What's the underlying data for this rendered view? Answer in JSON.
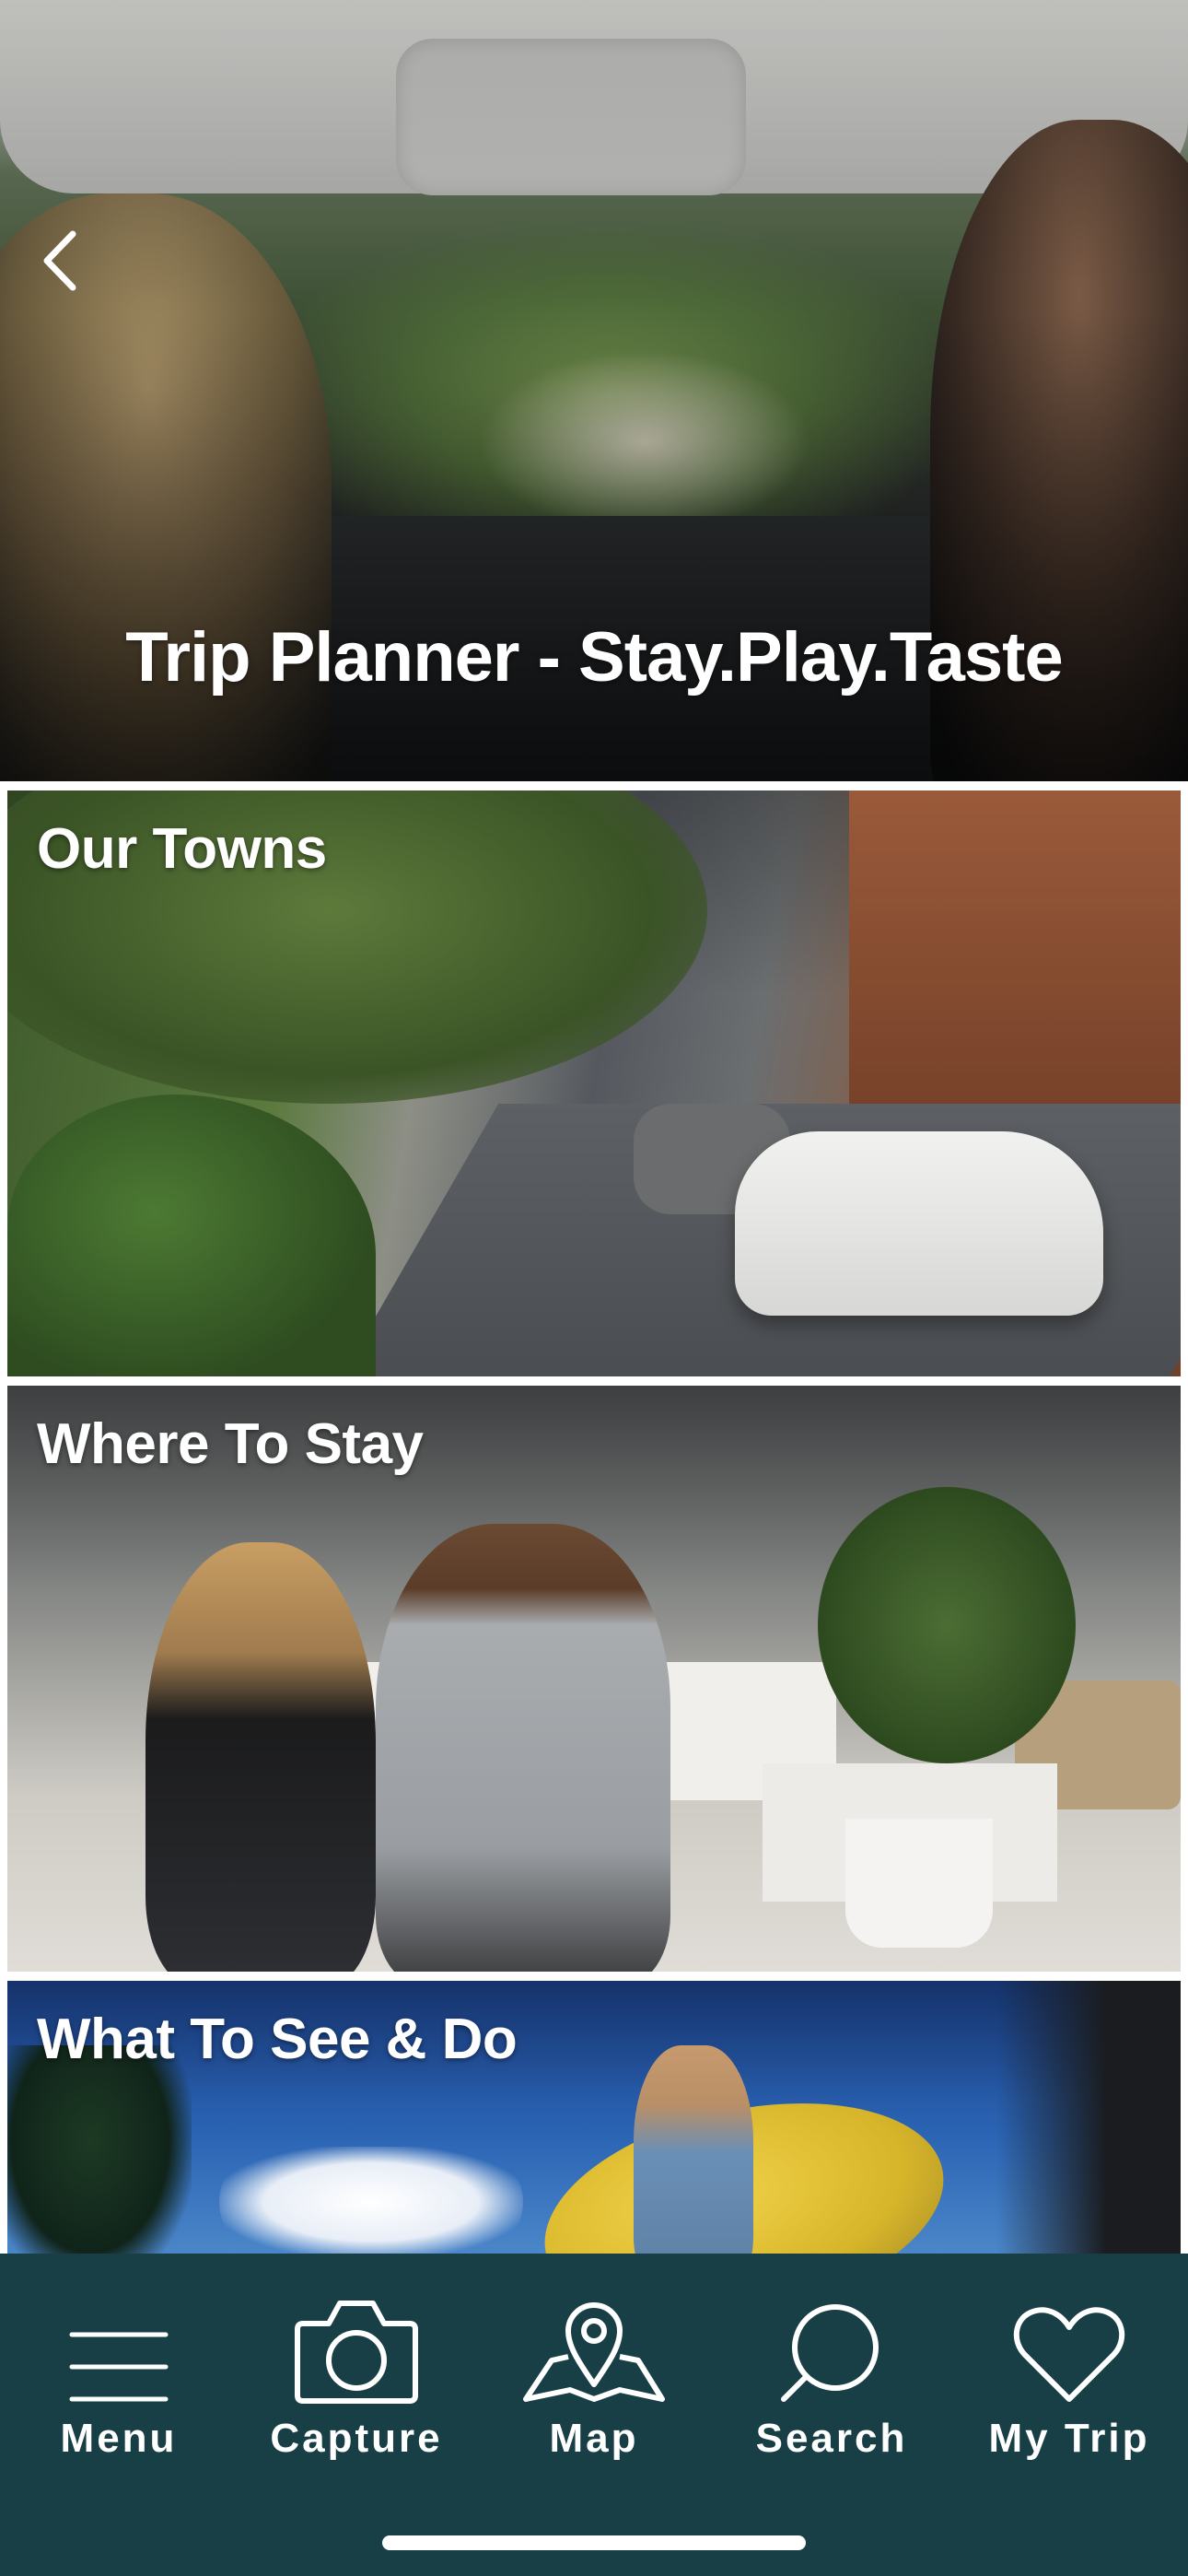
{
  "header": {
    "back_icon": "chevron-left-icon",
    "title": "Trip Planner - Stay.Play.Taste"
  },
  "tiles": [
    {
      "label": "Our Towns"
    },
    {
      "label": "Where To Stay"
    },
    {
      "label": "What To See & Do"
    }
  ],
  "tabbar": {
    "items": [
      {
        "label": "Menu",
        "icon": "hamburger-menu-icon"
      },
      {
        "label": "Capture",
        "icon": "camera-icon"
      },
      {
        "label": "Map",
        "icon": "map-pin-icon"
      },
      {
        "label": "Search",
        "icon": "search-icon"
      },
      {
        "label": "My Trip",
        "icon": "heart-icon"
      }
    ],
    "background": "#183f45"
  }
}
